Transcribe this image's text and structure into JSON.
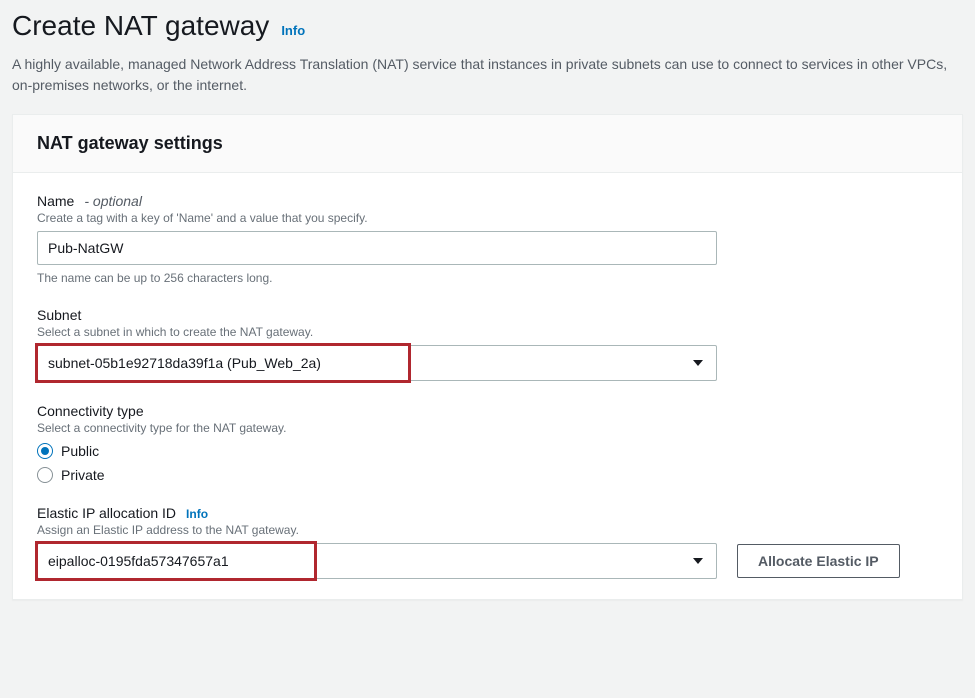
{
  "header": {
    "title": "Create NAT gateway",
    "info_label": "Info",
    "description": "A highly available, managed Network Address Translation (NAT) service that instances in private subnets can use to connect to services in other VPCs, on-premises networks, or the internet."
  },
  "panel": {
    "title": "NAT gateway settings"
  },
  "fields": {
    "name": {
      "label": "Name",
      "optional_suffix": "- optional",
      "helper": "Create a tag with a key of 'Name' and a value that you specify.",
      "value": "Pub-NatGW",
      "footer": "The name can be up to 256 characters long."
    },
    "subnet": {
      "label": "Subnet",
      "helper": "Select a subnet in which to create the NAT gateway.",
      "value": "subnet-05b1e92718da39f1a (Pub_Web_2a)"
    },
    "connectivity": {
      "label": "Connectivity type",
      "helper": "Select a connectivity type for the NAT gateway.",
      "options": {
        "public": "Public",
        "private": "Private"
      },
      "selected": "public"
    },
    "eip": {
      "label": "Elastic IP allocation ID",
      "info_label": "Info",
      "helper": "Assign an Elastic IP address to the NAT gateway.",
      "value": "eipalloc-0195fda57347657a1",
      "allocate_button": "Allocate Elastic IP"
    }
  }
}
